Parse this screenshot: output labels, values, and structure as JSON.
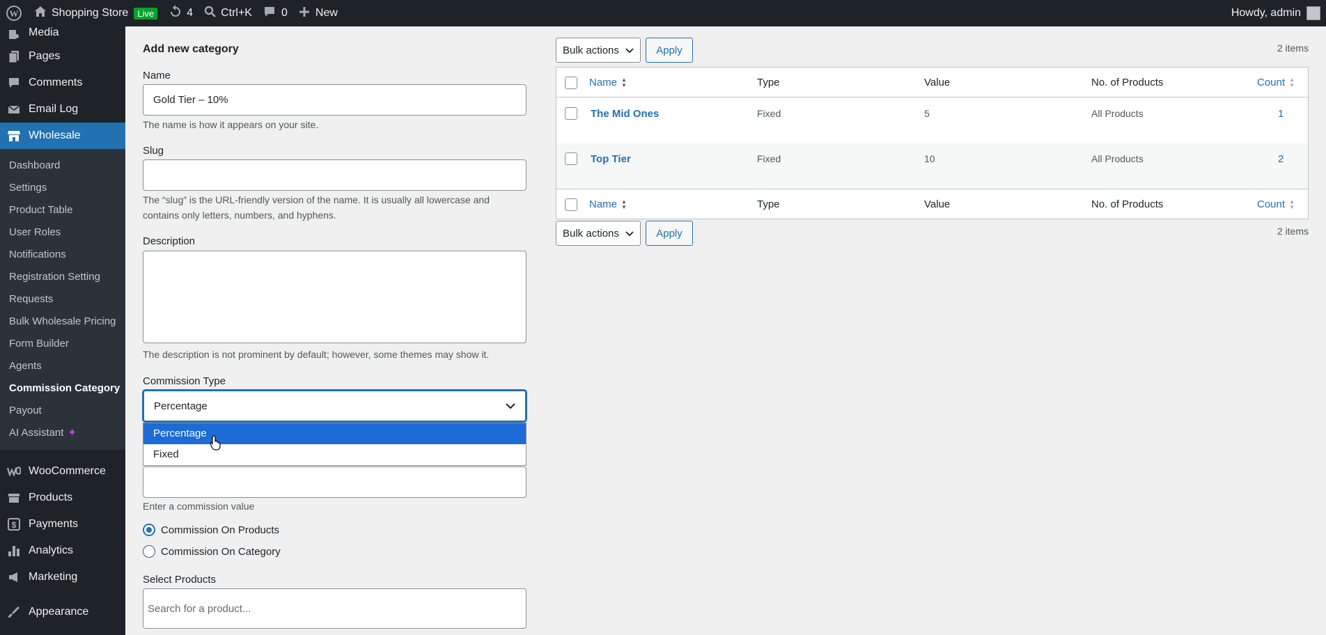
{
  "adminbar": {
    "site_name": "Shopping Store",
    "live_badge": "Live",
    "updates_count": "4",
    "search_shortcut": "Ctrl+K",
    "comments_count": "0",
    "new_label": "New",
    "greeting": "Howdy, admin"
  },
  "sidebar": {
    "top_items": [
      {
        "label": "Media",
        "icon": "media-icon"
      },
      {
        "label": "Pages",
        "icon": "pages-icon"
      },
      {
        "label": "Comments",
        "icon": "comments-icon"
      },
      {
        "label": "Email Log",
        "icon": "email-icon"
      },
      {
        "label": "Wholesale",
        "icon": "store-icon"
      }
    ],
    "submenu": [
      "Dashboard",
      "Settings",
      "Product Table",
      "User Roles",
      "Notifications",
      "Registration Setting",
      "Requests",
      "Bulk Wholesale Pricing",
      "Form Builder",
      "Agents",
      "Commission Category",
      "Payout",
      "AI Assistant"
    ],
    "bottom_items": [
      {
        "label": "WooCommerce",
        "icon": "woocommerce-icon"
      },
      {
        "label": "Products",
        "icon": "products-icon"
      },
      {
        "label": "Payments",
        "icon": "payments-icon"
      },
      {
        "label": "Analytics",
        "icon": "analytics-icon"
      },
      {
        "label": "Marketing",
        "icon": "marketing-icon"
      },
      {
        "label": "Appearance",
        "icon": "appearance-icon"
      }
    ]
  },
  "form": {
    "heading": "Add new category",
    "name_label": "Name",
    "name_value": "Gold Tier – 10%",
    "name_help": "The name is how it appears on your site.",
    "slug_label": "Slug",
    "slug_value": "",
    "slug_help": "The “slug” is the URL-friendly version of the name. It is usually all lowercase and contains only letters, numbers, and hyphens.",
    "description_label": "Description",
    "description_value": "",
    "description_help": "The description is not prominent by default; however, some themes may show it.",
    "commission_type_label": "Commission Type",
    "commission_type_value": "Percentage",
    "commission_type_options": [
      "Percentage",
      "Fixed"
    ],
    "commission_value": "",
    "commission_value_help": "Enter a commission value",
    "radio_products": "Commission On Products",
    "radio_category": "Commission On Category",
    "select_products_label": "Select Products",
    "select_products_placeholder": "Search for a product..."
  },
  "table": {
    "bulk_actions": "Bulk actions",
    "apply": "Apply",
    "items_count": "2 items",
    "headers": {
      "name": "Name",
      "type": "Type",
      "value": "Value",
      "products": "No. of Products",
      "count": "Count"
    },
    "rows": [
      {
        "name": "The Mid Ones",
        "type": "Fixed",
        "value": "5",
        "products": "All Products",
        "count": "1"
      },
      {
        "name": "Top Tier",
        "type": "Fixed",
        "value": "10",
        "products": "All Products",
        "count": "2"
      }
    ]
  }
}
